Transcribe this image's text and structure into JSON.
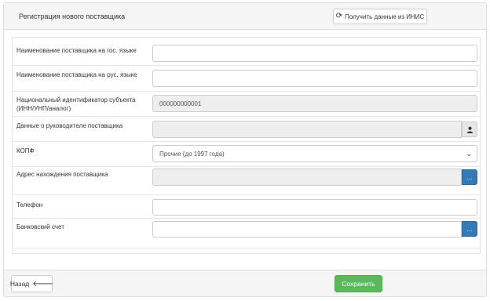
{
  "header": {
    "title": "Регистрация нового поставщика",
    "fetch_button_label": "Получить данные из ИНИС",
    "fetch_button_icon": "refresh-icon"
  },
  "form": {
    "name_state_lang": {
      "label": "Наименование поставщика на гос. языке",
      "value": ""
    },
    "name_rus_lang": {
      "label": "Наименование поставщика на рус. языке",
      "value": ""
    },
    "national_id": {
      "label": "Национальный идентификатор субъекта (ИНН/УНП/аналог)",
      "value": "000000000001"
    },
    "head_info": {
      "label": "Данные о руководителе поставщика",
      "value": "",
      "button_icon": "user-icon"
    },
    "kopf": {
      "label": "КОПФ",
      "selected": "Прочие (до 1997 года)"
    },
    "address": {
      "label": "Адрес нахождения поставщика",
      "value": "",
      "button_label": "..."
    },
    "phone": {
      "label": "Телефон",
      "value": ""
    },
    "bank_account": {
      "label": "Банковский счет",
      "value": "",
      "button_label": "..."
    }
  },
  "footer": {
    "back_label": "Назад",
    "back_icon": "arrow-left-icon",
    "save_label": "Сохранить"
  },
  "colors": {
    "primary": "#337ab7",
    "success": "#5cb85c",
    "panel_bg": "#f5f5f5",
    "readonly_bg": "#eeeeee"
  }
}
